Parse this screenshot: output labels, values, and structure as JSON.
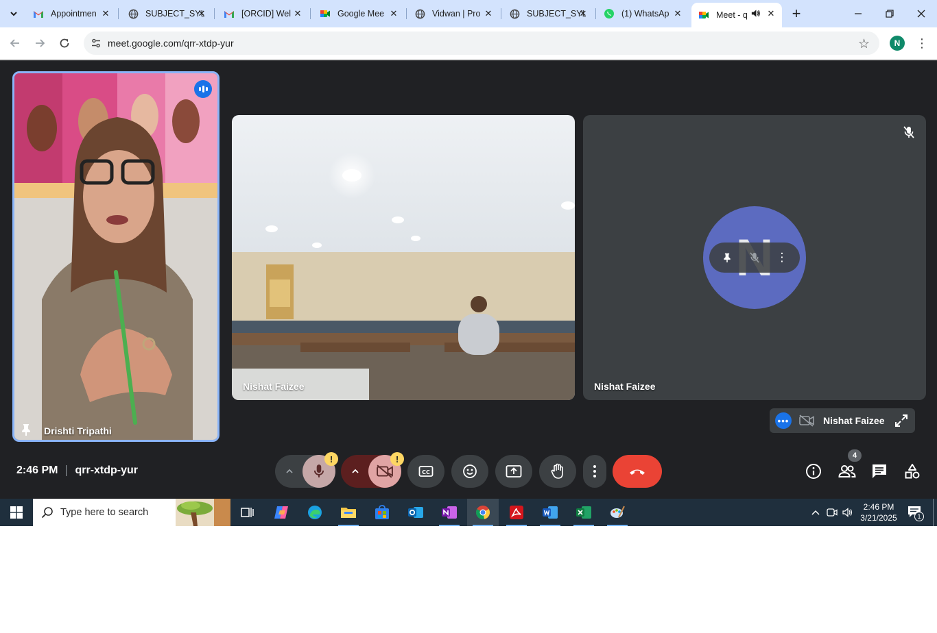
{
  "browser": {
    "tabs": [
      {
        "title": "Appointmen",
        "icon": "gmail-icon"
      },
      {
        "title": "SUBJECT_SYL",
        "icon": "globe-icon"
      },
      {
        "title": "[ORCID] Wel",
        "icon": "gmail-icon"
      },
      {
        "title": "Google Mee",
        "icon": "meet-icon"
      },
      {
        "title": "Vidwan | Pro",
        "icon": "globe-icon"
      },
      {
        "title": "SUBJECT_SYL",
        "icon": "globe-icon"
      },
      {
        "title": "(1) WhatsAp",
        "icon": "whatsapp-icon"
      },
      {
        "title": "Meet - q",
        "icon": "meet-icon",
        "active": true,
        "audio": true
      }
    ],
    "url": "meet.google.com/qrr-xtdp-yur",
    "profile_initial": "N",
    "accent": "#d3e3fd"
  },
  "meet": {
    "tiles": {
      "speaker_name": "Drishti Tripathi",
      "classroom_name": "Nishat Faizee",
      "avatar_name": "Nishat Faizee",
      "avatar_initial": "N"
    },
    "self_view": {
      "name": "Nishat Faizee"
    },
    "clock": "2:46 PM",
    "meeting_code": "qrr-xtdp-yur",
    "participant_count": "4",
    "warning_mark": "!",
    "colors": {
      "background": "#202124",
      "end_call": "#ea4335",
      "mic_off": "#c5a7a7",
      "active_border": "#8ab4f8"
    }
  },
  "taskbar": {
    "search_placeholder": "Type here to search",
    "time": "2:46 PM",
    "date": "3/21/2025",
    "notification_count": "1"
  }
}
